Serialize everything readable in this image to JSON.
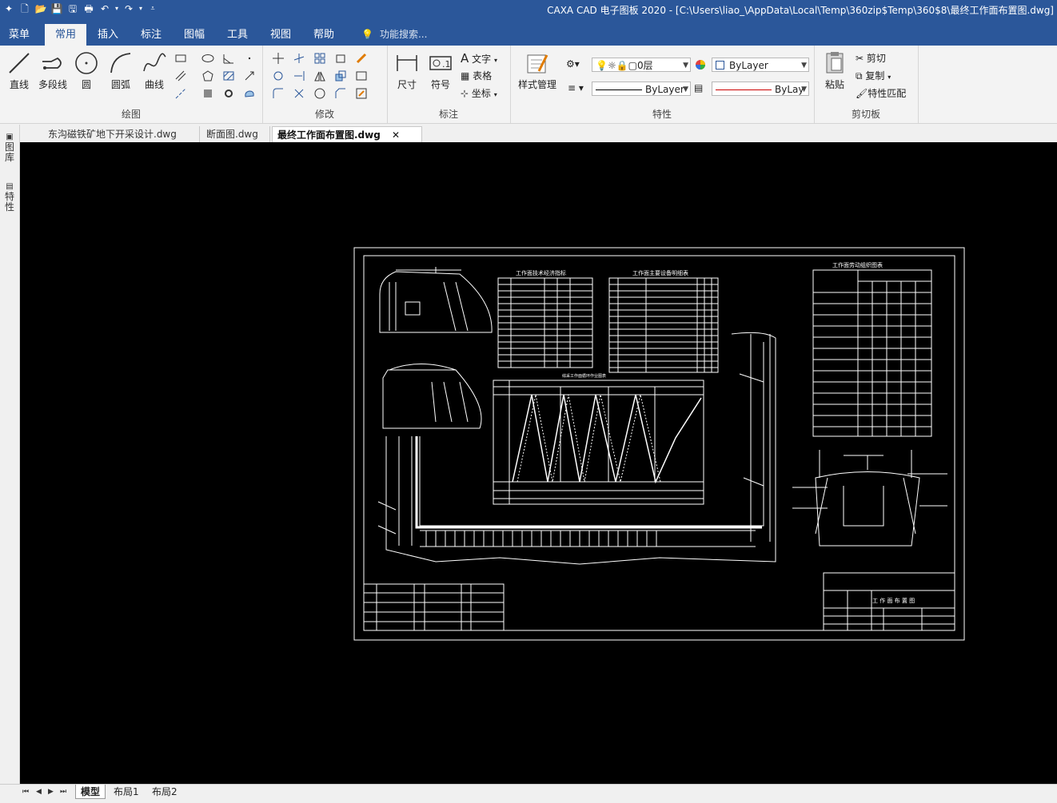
{
  "window": {
    "title": "CAXA CAD 电子图板 2020 - [C:\\Users\\liao_\\AppData\\Local\\Temp\\360zip$Temp\\360$8\\最终工作面布置图.dwg]"
  },
  "menu": {
    "items": [
      "菜单",
      "常用",
      "插入",
      "标注",
      "图幅",
      "工具",
      "视图",
      "帮助"
    ],
    "active": "常用",
    "search_placeholder": "功能搜索..."
  },
  "ribbon": {
    "draw": {
      "title": "绘图",
      "line": "直线",
      "polyline": "多段线",
      "circle": "圆",
      "arc": "圆弧",
      "curve": "曲线"
    },
    "modify": {
      "title": "修改"
    },
    "annotate": {
      "title": "标注",
      "dimension": "尺寸",
      "symbol": "符号",
      "text": "文字",
      "table": "表格",
      "coordinate": "坐标"
    },
    "properties": {
      "title": "特性",
      "style_manager": "样式管理",
      "layer": "0层",
      "color": "ByLayer",
      "linetype": "ByLayer",
      "lineweight": "ByLay"
    },
    "clipboard": {
      "title": "剪切板",
      "paste": "粘贴",
      "cut": "剪切",
      "copy": "复制",
      "match": "特性匹配"
    }
  },
  "doc_tabs": [
    {
      "label": "东沟磁铁矿地下开采设计.dwg",
      "active": false
    },
    {
      "label": "断面图.dwg",
      "active": false
    },
    {
      "label": "最终工作面布置图.dwg",
      "active": true
    }
  ],
  "side_panel": {
    "library": "图库",
    "properties": "特性"
  },
  "drawing": {
    "title_tech": "工作面技术经济指标",
    "title_equipment": "工作面主要设备明细表",
    "title_labor": "工作面劳动组织图表",
    "title_cycle": "综采工作面循环作业图表",
    "title_block": "工 作 面 布 置 图"
  },
  "layout_tabs": [
    "模型",
    "布局1",
    "布局2"
  ],
  "layout_active": "模型"
}
